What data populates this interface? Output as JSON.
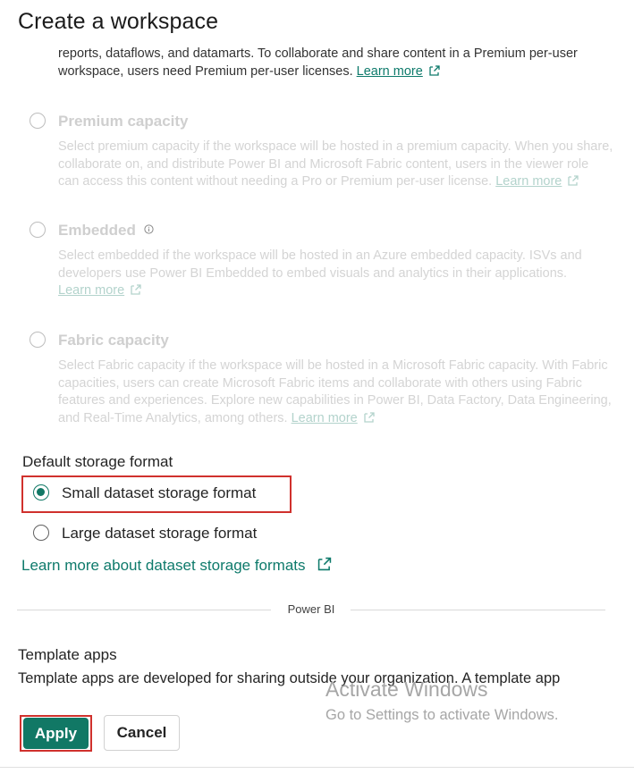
{
  "dialog": {
    "title": "Create a workspace"
  },
  "license_options": [
    {
      "id": "premium-per-user",
      "lines": [
        "reports, dataflows, and datamarts. To collaborate and share content in a Premium per-user",
        "workspace, users need Premium per-user licenses."
      ],
      "link": "Learn more",
      "enabled": true
    },
    {
      "id": "premium-capacity",
      "label": "Premium capacity",
      "lines": [
        "Select premium capacity if the workspace will be hosted in a premium capacity. When you share,",
        "collaborate on, and distribute Power BI and Microsoft Fabric content, users in the viewer role",
        "can access this content without needing a Pro or Premium per-user license."
      ],
      "link": "Learn more",
      "enabled": false
    },
    {
      "id": "embedded",
      "label": "Embedded",
      "lines": [
        "Select embedded if the workspace will be hosted in an Azure embedded capacity. ISVs and",
        "developers use Power BI Embedded to embed visuals and analytics in their applications."
      ],
      "link": "Learn more",
      "enabled": false
    },
    {
      "id": "fabric-capacity",
      "label": "Fabric capacity",
      "lines": [
        "Select Fabric capacity if the workspace will be hosted in a Microsoft Fabric capacity. With Fabric",
        "capacities, users can create Microsoft Fabric items and collaborate with others using Fabric",
        "features and experiences. Explore new capabilities in Power BI, Data Factory, Data Engineering,",
        "and Real-Time Analytics, among others."
      ],
      "link": "Learn more",
      "enabled": false
    }
  ],
  "storage": {
    "heading": "Default storage format",
    "options": [
      {
        "label": "Small dataset storage format",
        "checked": true
      },
      {
        "label": "Large dataset storage format",
        "checked": false
      }
    ],
    "learn_more": "Learn more about dataset storage formats"
  },
  "divider": {
    "label": "Power BI"
  },
  "template_apps": {
    "heading": "Template apps",
    "description": "Template apps are developed for sharing outside your organization. A template app"
  },
  "watermark": {
    "title": "Activate Windows",
    "subtitle": "Go to Settings to activate Windows."
  },
  "buttons": {
    "apply": "Apply",
    "cancel": "Cancel"
  },
  "colors": {
    "accent": "#117865",
    "link": "#0e7a6b",
    "highlight": "#d0312d"
  },
  "icons": [
    "external-link-icon",
    "info-icon",
    "radio-icon"
  ]
}
